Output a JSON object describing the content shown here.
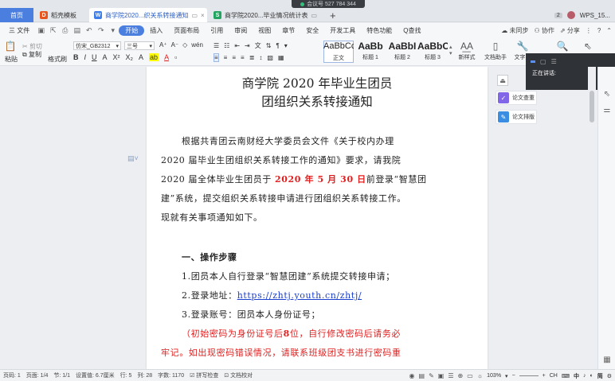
{
  "meeting": {
    "label": "会议号 527 784 344"
  },
  "tabs": {
    "home": "首页",
    "t1": "稻壳模板",
    "t2": "商学院2020...织关系转接通知",
    "t3": "商学院2020...毕业情况统计表"
  },
  "window": {
    "badge": "2",
    "user": "WPS_15..."
  },
  "menu": {
    "file": "三 文件",
    "items": [
      "开始",
      "插入",
      "页面布局",
      "引用",
      "审阅",
      "视图",
      "章节",
      "安全",
      "开发工具",
      "特色功能"
    ],
    "search": "Q查找",
    "right": [
      "未同步",
      "协作",
      "分享"
    ]
  },
  "ribbon": {
    "paste": "粘贴",
    "cut": "剪切",
    "copy": "复制",
    "format_painter": "格式刷",
    "font_name": "仿宋_GB2312",
    "font_size": "三号",
    "styles": [
      {
        "sample": "AaBbCcI",
        "name": "正文"
      },
      {
        "sample": "AaBb",
        "name": "标题 1"
      },
      {
        "sample": "AaBbI",
        "name": "标题 2"
      },
      {
        "sample": "AaBbC",
        "name": "标题 3"
      }
    ],
    "new_style": "新样式",
    "doc_helper": "文档助手",
    "text_tools": "文字工"
  },
  "document": {
    "title_line1": "商学院 2020 年毕业生团员",
    "title_line2": "团组织关系转接通知",
    "p1_a": "根据共青团云南财经大学委员会文件《关于校内办理",
    "p1_b": "2020 届毕业生团组织关系转接工作的通知》要求，请我院",
    "p1_c1": "2020 届全体毕业生团员于",
    "p1_c2": "2020 年 5 月 30 日",
    "p1_c3": "前登录“智慧团",
    "p1_d": "建”系统，提交组织关系转接申请进行团组织关系转接工作。",
    "p1_e": "现就有关事项通知如下。",
    "h1": "一、操作步骤",
    "s1": "1.团员本人自行登录“智慧团建”系统提交转接申请；",
    "s2_label": "2.登录地址：",
    "s2_link": "https://zhtj.youth.cn/zhtj/",
    "s3": "3.登录账号：团员本人身份证号；",
    "note_a1": "（初始密码为身份证号后",
    "note_a2": "8",
    "note_a3": "位，自行修改密码后请务必",
    "note_b": "牢记。如出现密码错误情况，请联系班级团支书进行密码重"
  },
  "float_tools": {
    "check": "论文查重",
    "format": "论文排版"
  },
  "speaking": {
    "label": "正在讲话:"
  },
  "status": {
    "page_no": "页码: 1",
    "pages": "页面: 1/4",
    "section": "节: 1/1",
    "setting": "设置值: 6.7厘米",
    "row": "行: 5",
    "col": "列: 28",
    "chars": "字数: 1170",
    "spell": "拼写检查",
    "proof": "文档校对",
    "zoom": "103%",
    "ime": "中",
    "ime2": "简"
  }
}
